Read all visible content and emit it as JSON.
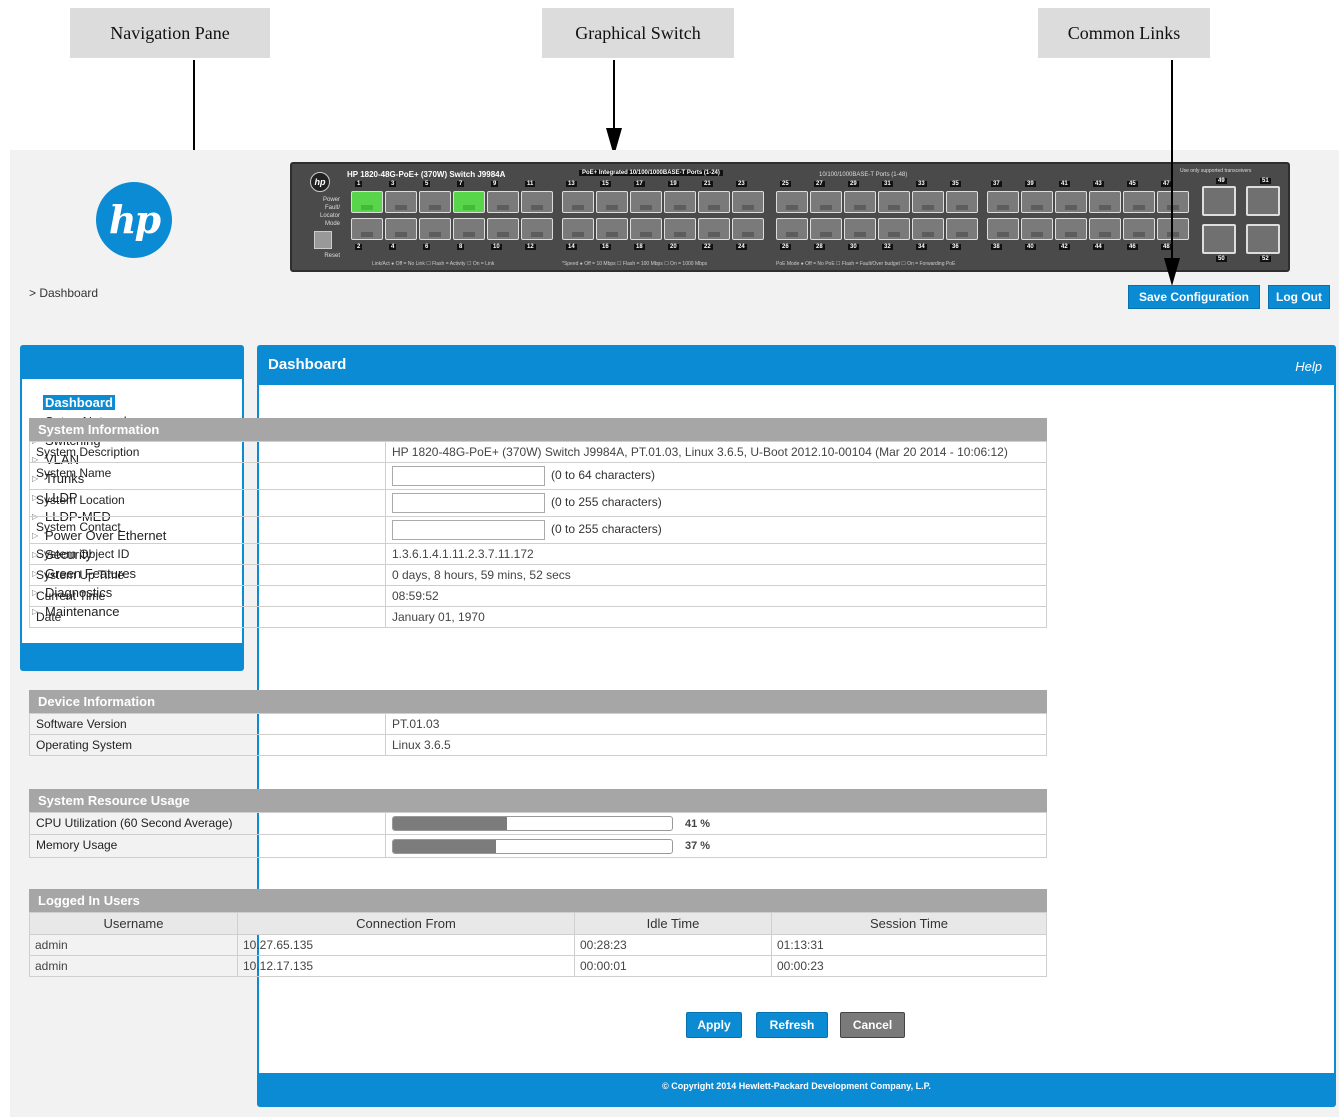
{
  "callouts": {
    "navigation": "Navigation Pane",
    "switch": "Graphical Switch",
    "links": "Common Links"
  },
  "breadcrumb": "> Dashboard",
  "switch_graphic": {
    "model": "HP 1820-48G-PoE+ (370W) Switch J9984A",
    "poe_bank_label": "PoE+ Integrated 10/100/1000BASE-T Ports (1-24)",
    "ports_label": "10/100/1000BASE-T Ports (1-48)",
    "transceiver_note": "Use only supported transceivers",
    "left_labels": [
      "Power",
      "Fault/",
      "Locator",
      "Mode",
      "Reset"
    ],
    "legend_1": "Link/Act  ● Off = No Link  ☐ Flash = Activity  ☐ On = Link",
    "legend_2": "*Speed  ● Off = 10 Mbps  ☐ Flash = 100 Mbps  ☐ On = 1000 Mbps",
    "legend_3": "PoE Mode  ● Off = No PoE  ☐ Flash = Fault/Over budget  ☐ On = Forwarding PoE",
    "port_numbers_top": [
      "1",
      "3",
      "5",
      "7",
      "9",
      "11",
      "13",
      "15",
      "17",
      "19",
      "21",
      "23",
      "25",
      "27",
      "29",
      "31",
      "33",
      "35",
      "37",
      "39",
      "41",
      "43",
      "45",
      "47"
    ],
    "port_numbers_bottom": [
      "2",
      "4",
      "6",
      "8",
      "10",
      "12",
      "14",
      "16",
      "18",
      "20",
      "22",
      "24",
      "26",
      "28",
      "30",
      "32",
      "34",
      "36",
      "38",
      "40",
      "42",
      "44",
      "46",
      "48"
    ],
    "sfp_numbers": [
      "49",
      "51",
      "50",
      "52"
    ]
  },
  "top_links": {
    "save": "Save Configuration",
    "logout": "Log Out"
  },
  "nav": {
    "items": [
      {
        "label": "Dashboard"
      },
      {
        "label": "Setup Network"
      },
      {
        "label": "Switching"
      },
      {
        "label": "VLAN"
      },
      {
        "label": "Trunks"
      },
      {
        "label": "LLDP"
      },
      {
        "label": "LLDP-MED"
      },
      {
        "label": "Power Over Ethernet"
      },
      {
        "label": "Security"
      },
      {
        "label": "Green Features"
      },
      {
        "label": "Diagnostics"
      },
      {
        "label": "Maintenance"
      }
    ]
  },
  "main": {
    "title": "Dashboard",
    "help": "Help",
    "footer": "© Copyright 2014 Hewlett-Packard Development Company, L.P."
  },
  "system_info": {
    "heading": "System Information",
    "description_label": "System Description",
    "description_value": "HP 1820-48G-PoE+ (370W) Switch J9984A, PT.01.03, Linux 3.6.5, U-Boot 2012.10-00104 (Mar 20 2014 - 10:06:12)",
    "name_label": "System Name",
    "name_value": "",
    "name_hint": "(0 to 64 characters)",
    "location_label": "System Location",
    "location_value": "",
    "location_hint": "(0 to 255 characters)",
    "contact_label": "System Contact",
    "contact_value": "",
    "contact_hint": "(0 to 255 characters)",
    "oid_label": "System Object ID",
    "oid_value": "1.3.6.1.4.1.11.2.3.7.11.172",
    "uptime_label": "System Up Time",
    "uptime_value": "0 days, 8 hours, 59 mins, 52 secs",
    "time_label": "Current Time",
    "time_value": "08:59:52",
    "date_label": "Date",
    "date_value": "January 01, 1970"
  },
  "device_info": {
    "heading": "Device Information",
    "sw_label": "Software Version",
    "sw_value": "PT.01.03",
    "os_label": "Operating System",
    "os_value": "Linux 3.6.5"
  },
  "resource_usage": {
    "heading": "System Resource Usage",
    "cpu_label": "CPU Utilization (60 Second Average)",
    "cpu_percent": 41,
    "cpu_text": "41 %",
    "mem_label": "Memory Usage",
    "mem_percent": 37,
    "mem_text": "37 %"
  },
  "logged_users": {
    "heading": "Logged In Users",
    "columns": [
      "Username",
      "Connection From",
      "Idle Time",
      "Session Time"
    ],
    "rows": [
      [
        "admin",
        "10.27.65.135",
        "00:28:23",
        "01:13:31"
      ],
      [
        "admin",
        "10.12.17.135",
        "00:00:01",
        "00:00:23"
      ]
    ]
  },
  "actions": {
    "apply": "Apply",
    "refresh": "Refresh",
    "cancel": "Cancel"
  },
  "colors": {
    "accent": "#0a8bd3",
    "section_header": "#a6a6a6",
    "port_active": "#59d54c"
  }
}
